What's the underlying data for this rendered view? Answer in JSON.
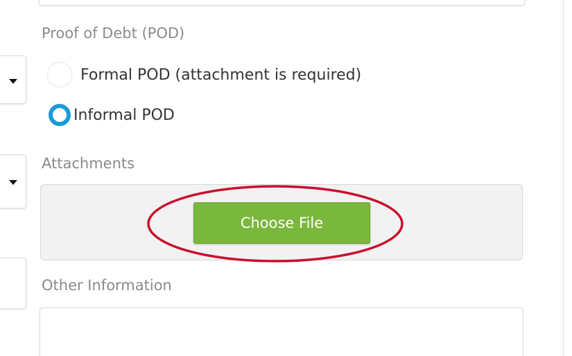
{
  "pod_section": {
    "label": "Proof of Debt (POD)",
    "options": [
      {
        "label": "Formal POD (attachment is required)",
        "selected": false
      },
      {
        "label": "Informal POD",
        "selected": true
      }
    ]
  },
  "attachments": {
    "label": "Attachments",
    "button_label": "Choose File"
  },
  "other_information": {
    "label": "Other Information",
    "value": ""
  },
  "colors": {
    "radio_selected": "#1a9ad6",
    "button_green": "#7ab73d",
    "highlight": "#c8102e"
  },
  "icons": {
    "dropdown": "caret-down-icon"
  }
}
